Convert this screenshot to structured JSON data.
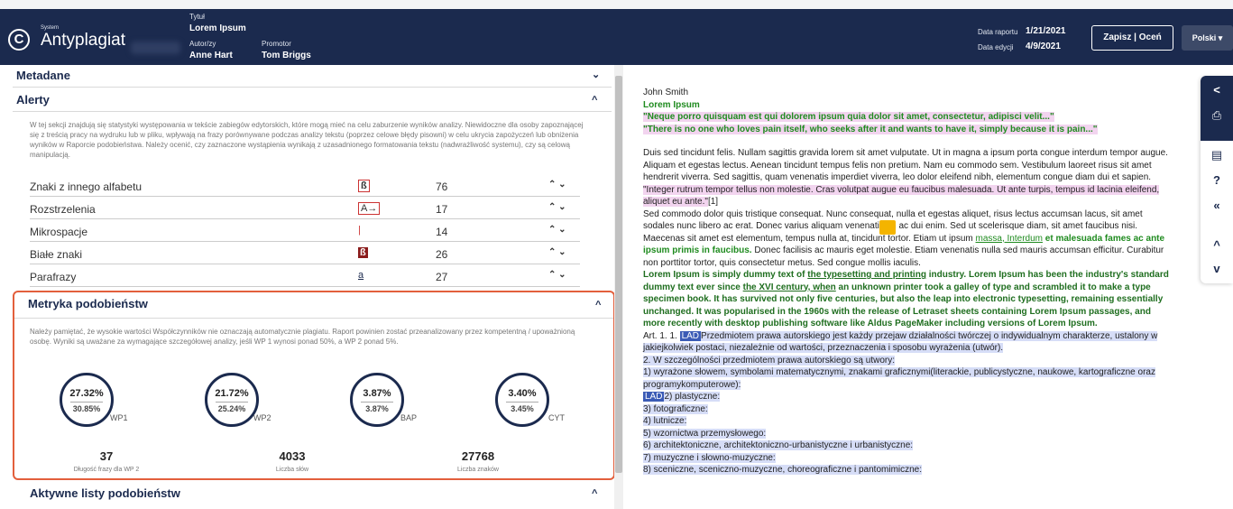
{
  "header": {
    "logo_system": "System",
    "logo_name": "Antyplagiat",
    "title_label": "Tytuł",
    "title_value": "Lorem Ipsum",
    "author_label": "Autor/zy",
    "author_value": "Anne Hart",
    "promotor_label": "Promotor",
    "promotor_value": "Tom Briggs",
    "report_date_label": "Data raportu",
    "report_date_value": "1/21/2021",
    "edit_date_label": "Data edycji",
    "edit_date_value": "4/9/2021",
    "save_button": "Zapisz | Oceń",
    "language_button": "Polski ▾"
  },
  "sections": {
    "metadata": "Metadane",
    "alerts": "Alerty",
    "metrics": "Metryka podobieństw",
    "active_lists": "Aktywne listy podobieństw"
  },
  "alerts": {
    "description": "W tej sekcji znajdują się statystyki występowania w tekście zabiegów edytorskich, które mogą mieć na celu zaburzenie wyników analizy. Niewidoczne dla osoby zapoznającej się z treścią pracy na wydruku lub w pliku, wpływają na frazy porównywane podczas analizy tekstu (poprzez celowe błędy pisowni) w celu ukrycia zapożyczeń lub obniżenia wyników w Raporcie podobieństwa. Należy ocenić, czy zaznaczone wystąpienia wynikają z uzasadnionego formatowania tekstu (nadwrażliwość systemu), czy są celową manipulacją.",
    "rows": [
      {
        "name": "Znaki z innego alfabetu",
        "glyph": "ß",
        "count": "76"
      },
      {
        "name": "Rozstrzelenia",
        "glyph": "A→",
        "count": "17"
      },
      {
        "name": "Mikrospacje",
        "glyph": "|",
        "count": "14"
      },
      {
        "name": "Białe znaki",
        "glyph": "ß",
        "count": "26"
      },
      {
        "name": "Parafrazy",
        "glyph": "a",
        "count": "27"
      }
    ]
  },
  "metrics": {
    "description": "Należy pamiętać, że wysokie wartości Współczynników nie oznaczają automatycznie plagiatu. Raport powinien zostać przeanalizowany przez kompetentną / upoważnioną osobę. Wyniki są uważane za wymagające szczegółowej analizy, jeśli WP 1 wynosi ponad 50%, a WP 2 ponad 5%.",
    "circles": [
      {
        "top": "27.32%",
        "bottom": "30.85%",
        "label": "WP1"
      },
      {
        "top": "21.72%",
        "bottom": "25.24%",
        "label": "WP2"
      },
      {
        "top": "3.87%",
        "bottom": "3.87%",
        "label": "BAP"
      },
      {
        "top": "3.40%",
        "bottom": "3.45%",
        "label": "CYT"
      }
    ],
    "stats": [
      {
        "value": "37",
        "label": "Długość frazy dla WP 2"
      },
      {
        "value": "4033",
        "label": "Liczba słów"
      },
      {
        "value": "27768",
        "label": "Liczba znaków"
      }
    ]
  },
  "document": {
    "author": "John Smith",
    "title": "Lorem Ipsum",
    "quote1": "\"Neque porro quisquam est qui dolorem ipsum quia dolor sit amet, consectetur, adipisci velit...\"",
    "quote2": "\"There is no one who loves pain itself, who seeks after it and wants to have it, simply because it is pain...\"",
    "p1": "Duis sed tincidunt felis. Nullam sagittis gravida lorem sit amet vulputate. Ut in magna a ipsum porta congue interdum tempor augue. Aliquam et egestas lectus. Aenean tincidunt tempus felis non pretium. Nam eu commodo sem. Vestibulum laoreet risus sit amet hendrerit viverra. Sed sagittis, quam venenatis imperdiet viverra, leo dolor eleifend nibh, elementum congue diam dui et sapien.",
    "p1_pink": "\"Integer rutrum tempor tellus non molestie. Cras volutpat augue eu faucibus malesuada. Ut ante turpis, tempus id lacinia eleifend, aliquet eu ante.\"",
    "p1_ref": "[1]",
    "p2a": "Sed commodo dolor quis tristique consequat. Nunc consequat, nulla et egestas aliquet, risus lectus accumsan lacus, sit amet sodales nunc libero ac erat. Donec varius aliquam venenatis. In ac dui enim. Sed ut scelerisque diam, sit amet faucibus nisi. Maecenas sit amet est elementum, tempus nulla at, tincidunt tortor. Etiam ut ipsum ",
    "p2_green_ul": "massa, Interdum",
    "p2_green": " et malesuada fames ac ante ipsum primis in faucibus.",
    "p2b": " Donec facilisis ac mauris eget molestie. Etiam venenatis nulla sed mauris accumsan efficitur. Curabitur non porttitor tortor, quis consectetur metus. Sed congue mollis iaculis.",
    "p3a": "Lorem Ipsum is simply dummy text of ",
    "p3_ul1": "the typesetting and printing",
    "p3b": " industry. Lorem Ipsum has been the industry's standard dummy text ever since ",
    "p3_ul2": "the XVI century, when",
    "p3c": " an unknown printer took a galley of type and scrambled it to make a type specimen book. It has survived not only five centuries, but also the leap into electronic typesetting, remaining essentially unchanged. It was popularised in the 1960s with the release of Letraset sheets containing Lorem Ipsum passages, and more recently with desktop publishing software like Aldus PageMaker including versions of Lorem Ipsum.",
    "art_prefix": "Art. 1. 1. ",
    "lad": "LAD",
    "art_text": "Przedmiotem prawa autorskiego jest każdy przejaw działalności twórczej o indywidualnym charakterze, ustalony w jakiejkolwiek postaci, niezależnie od wartości, przeznaczenia i sposobu wyrażenia (utwór).",
    "art2": "2. W szczególności przedmiotem prawa autorskiego są utwory:",
    "item1": "1) wyrażone słowem, symbolami matematycznymi, znakami graficznymi(literackie, publicystyczne, naukowe, kartograficzne oraz programykomputerowe):",
    "item2": "2) plastyczne:",
    "item3": "3) fotograficzne:",
    "item4": "4) lutnicze:",
    "item5": "5) wzornictwa przemysłowego:",
    "item6": "6) architektoniczne, architektoniczno-urbanistyczne i urbanistyczne:",
    "item7": "7) muzyczne i słowno-muzyczne:",
    "item8": "8) sceniczne, sceniczno-muzyczne, choreograficzne i pantomimiczne:"
  },
  "icons": {
    "share": "<",
    "print": "⎙",
    "comment": "▤",
    "help": "?",
    "collapse": "«",
    "up": "^",
    "down": "v"
  },
  "colors": {
    "navy": "#1b2a4e",
    "highlight_orange": "#e35f3c",
    "pink": "#f2d4ef",
    "lavender": "#d6ddf7",
    "green_text": "#1f8b1f"
  }
}
